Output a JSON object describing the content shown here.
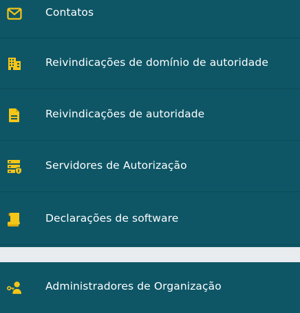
{
  "colors": {
    "background": "#0e5666",
    "icon": "#f5c518",
    "text": "#ffffff",
    "separator": "#e9ecef"
  },
  "menu": {
    "items": [
      {
        "label": "Contatos",
        "icon": "envelope-icon"
      },
      {
        "label": "Reivindicações de domínio de autoridade",
        "icon": "building-icon"
      },
      {
        "label": "Reivindicações de autoridade",
        "icon": "document-icon"
      },
      {
        "label": "Servidores de Autorização",
        "icon": "server-shield-icon"
      },
      {
        "label": "Declarações de software",
        "icon": "scroll-icon"
      },
      {
        "label": "Administradores de Organização",
        "icon": "user-key-icon"
      }
    ]
  }
}
